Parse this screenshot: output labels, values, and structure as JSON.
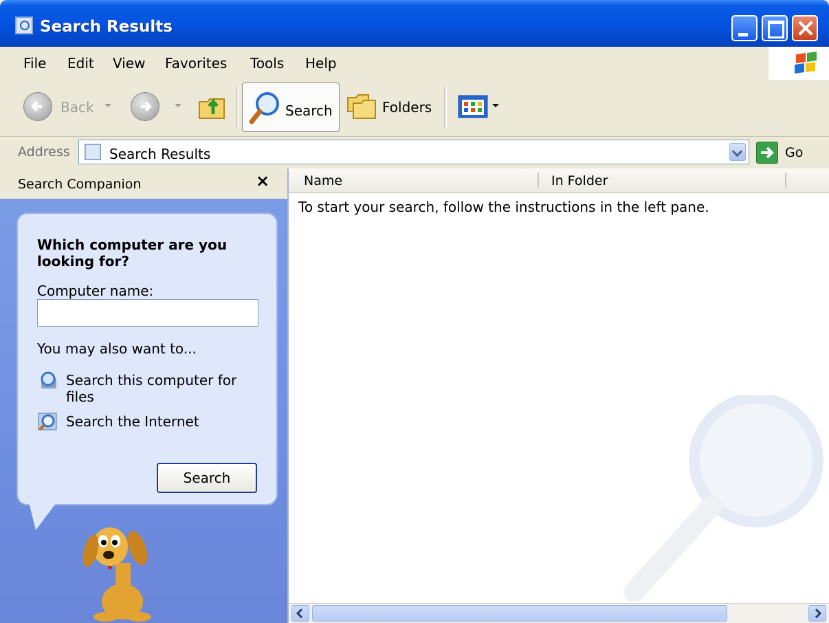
{
  "window": {
    "title": "Search Results"
  },
  "menu": {
    "items": [
      {
        "label": "File"
      },
      {
        "label": "Edit"
      },
      {
        "label": "View"
      },
      {
        "label": "Favorites"
      },
      {
        "label": "Tools"
      },
      {
        "label": "Help"
      }
    ]
  },
  "toolbar": {
    "back_label": "Back",
    "search_label": "Search",
    "folders_label": "Folders"
  },
  "address": {
    "label": "Address",
    "value": "Search Results",
    "go_label": "Go"
  },
  "search_companion": {
    "title": "Search Companion",
    "close_glyph": "×",
    "question": "Which computer are you looking for?",
    "computer_name_label": "Computer name:",
    "computer_name_value": "",
    "also_label": "You may also want to...",
    "links": [
      {
        "label": "Search this computer for files"
      },
      {
        "label": "Search the Internet"
      }
    ],
    "search_button_label": "Search"
  },
  "results": {
    "columns": [
      {
        "label": "Name"
      },
      {
        "label": "In Folder"
      }
    ],
    "hint": "To start your search, follow the instructions in the left pane."
  },
  "colors": {
    "titlebar": "#0553e0",
    "left_pane": "#7c9ee8",
    "balloon": "#dfe7fb",
    "face": "#ece9d8"
  }
}
